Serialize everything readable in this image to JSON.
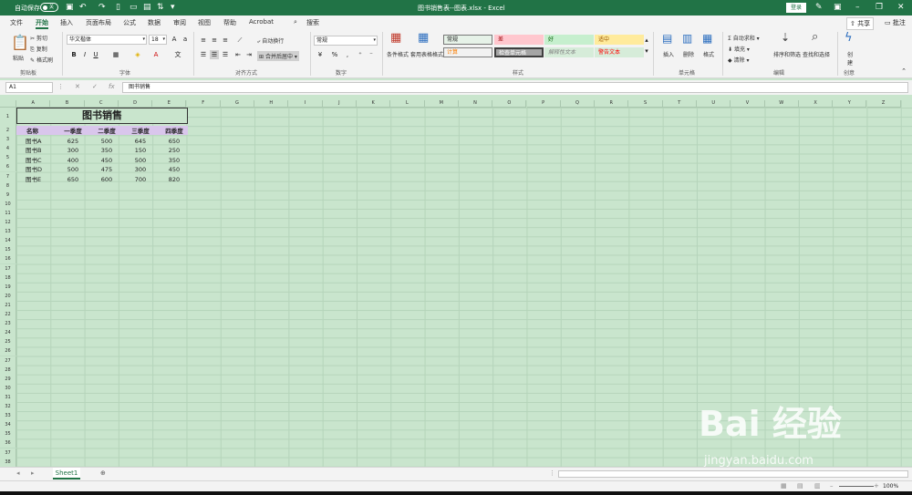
{
  "titlebar": {
    "autosave_label": "自动保存",
    "autosave_state": "关",
    "doc_title": "图书销售表--图表.xlsx  -  Excel",
    "login_label": "登录"
  },
  "menu": {
    "tabs": [
      "文件",
      "开始",
      "插入",
      "页面布局",
      "公式",
      "数据",
      "审阅",
      "视图",
      "帮助",
      "Acrobat"
    ],
    "search_label": "搜索",
    "share_label": "共享",
    "comment_label": "批注"
  },
  "ribbon": {
    "clipboard": {
      "paste": "粘贴",
      "cut": "剪切",
      "copy": "复制",
      "format_painter": "格式刷",
      "label": "剪贴板"
    },
    "font": {
      "name": "华文楷体",
      "size": "18",
      "label": "字体"
    },
    "alignment": {
      "wrap": "自动换行",
      "merge": "合并后居中",
      "label": "对齐方式"
    },
    "number": {
      "format": "常规",
      "label": "数字"
    },
    "styles": {
      "cond_format": "条件格式",
      "table_format": "套用表格格式",
      "cells": [
        {
          "text": "常规",
          "bg": "#e6f2e8",
          "color": "#222"
        },
        {
          "text": "差",
          "bg": "#ffc7ce",
          "color": "#9c0006"
        },
        {
          "text": "好",
          "bg": "#c6efce",
          "color": "#006100"
        },
        {
          "text": "适中",
          "bg": "#ffeb9c",
          "color": "#9c5700"
        },
        {
          "text": "计算",
          "bg": "#f2f2f2",
          "color": "#fa7d00"
        },
        {
          "text": "检查单元格",
          "bg": "#a5a5a5",
          "color": "#ffffff"
        },
        {
          "text": "解释性文本",
          "bg": "#d6ecd9",
          "color": "#7f7f7f"
        },
        {
          "text": "警告文本",
          "bg": "#d6ecd9",
          "color": "#ff0000"
        }
      ],
      "label": "样式"
    },
    "cells_group": {
      "insert": "插入",
      "delete": "删除",
      "format": "格式",
      "label": "单元格"
    },
    "editing": {
      "autosum": "自动求和",
      "fill": "填充",
      "clear": "清除",
      "sort": "排序和筛选",
      "find": "查找和选择",
      "label": "编辑"
    },
    "create": {
      "btn": "创建",
      "label": "创意"
    }
  },
  "formula_bar": {
    "name_box": "A1",
    "content": "图书销售"
  },
  "columns": [
    "A",
    "B",
    "C",
    "D",
    "E",
    "F",
    "G",
    "H",
    "I",
    "J",
    "K",
    "L",
    "M",
    "N",
    "O",
    "P",
    "Q",
    "R",
    "S",
    "T",
    "U",
    "V",
    "W",
    "X",
    "Y",
    "Z"
  ],
  "rows": [
    "1",
    "2",
    "3",
    "4",
    "5",
    "6",
    "7",
    "8",
    "9",
    "10",
    "11",
    "12",
    "13",
    "14",
    "15",
    "16",
    "17",
    "18",
    "19",
    "20",
    "21",
    "22",
    "23",
    "24",
    "25",
    "26",
    "27",
    "28",
    "29",
    "30",
    "31",
    "32",
    "33",
    "34",
    "35",
    "36",
    "37",
    "38",
    "39",
    "40"
  ],
  "table": {
    "title": "图书销售",
    "headers": [
      "名称",
      "一季度",
      "二季度",
      "三季度",
      "四季度"
    ],
    "rows": [
      [
        "图书A",
        "625",
        "500",
        "645",
        "650"
      ],
      [
        "图书B",
        "300",
        "350",
        "150",
        "250"
      ],
      [
        "图书C",
        "400",
        "450",
        "500",
        "350"
      ],
      [
        "图书D",
        "500",
        "475",
        "300",
        "450"
      ],
      [
        "图书E",
        "650",
        "600",
        "700",
        "820"
      ]
    ]
  },
  "sheet": {
    "name": "Sheet1"
  },
  "status": {
    "zoom": "100%"
  },
  "watermark": {
    "brand": "Bai 经验",
    "url": "jingyan.baidu.com"
  }
}
